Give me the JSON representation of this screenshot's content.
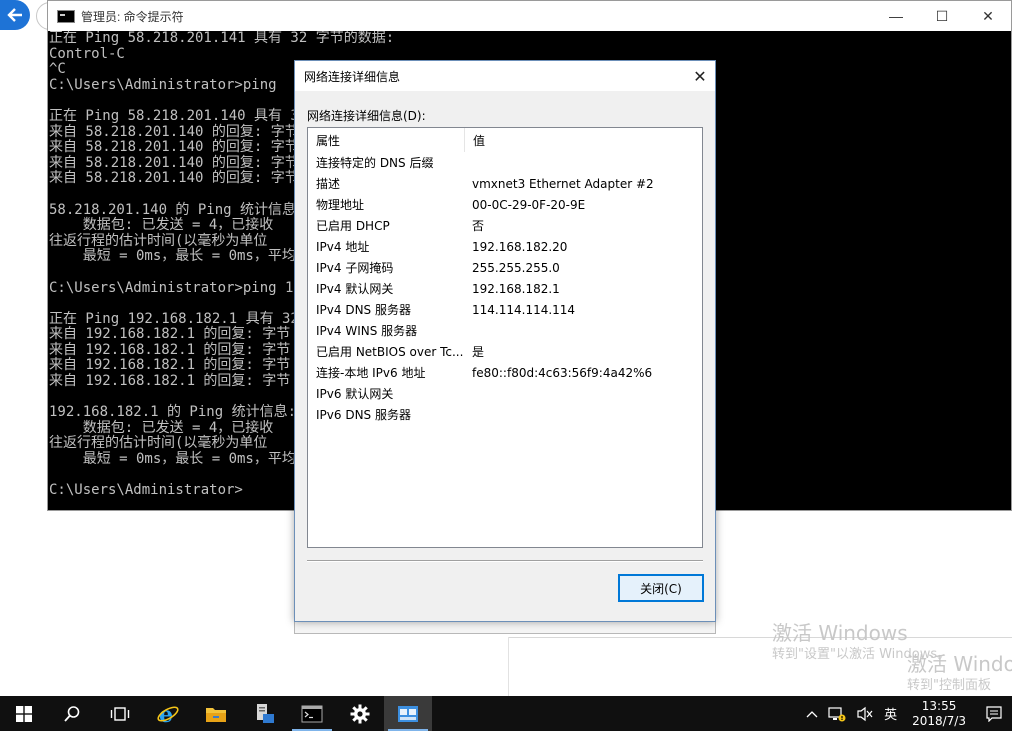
{
  "cmd": {
    "title": "管理员: 命令提示符",
    "lines": [
      "正在 Ping 58.218.201.141 具有 32 字节的数据:",
      "Control-C",
      "^C",
      "C:\\Users\\Administrator>ping  58",
      "",
      "正在 Ping 58.218.201.140 具有 3",
      "来自 58.218.201.140 的回复: 字节",
      "来自 58.218.201.140 的回复: 字节",
      "来自 58.218.201.140 的回复: 字节",
      "来自 58.218.201.140 的回复: 字节",
      "",
      "58.218.201.140 的 Ping 统计信息",
      "    数据包: 已发送 = 4，已接收",
      "往返行程的估计时间(以毫秒为单位",
      "    最短 = 0ms，最长 = 0ms，平均",
      "",
      "C:\\Users\\Administrator>ping 192",
      "",
      "正在 Ping 192.168.182.1 具有 32",
      "来自 192.168.182.1 的回复: 字节",
      "来自 192.168.182.1 的回复: 字节",
      "来自 192.168.182.1 的回复: 字节",
      "来自 192.168.182.1 的回复: 字节",
      "",
      "192.168.182.1 的 Ping 统计信息:",
      "    数据包: 已发送 = 4，已接收",
      "往返行程的估计时间(以毫秒为单位",
      "    最短 = 0ms，最长 = 0ms，平均",
      "",
      "C:\\Users\\Administrator>"
    ],
    "controls": {
      "minimize": "—",
      "maximize": "☐",
      "close": "✕"
    }
  },
  "dialog": {
    "title": "网络连接详细信息",
    "label": "网络连接详细信息(D):",
    "header": {
      "property": "属性",
      "value": "值"
    },
    "rows": [
      {
        "property": "连接特定的 DNS 后缀",
        "value": ""
      },
      {
        "property": "描述",
        "value": "vmxnet3 Ethernet Adapter #2"
      },
      {
        "property": "物理地址",
        "value": "00-0C-29-0F-20-9E"
      },
      {
        "property": "已启用 DHCP",
        "value": "否"
      },
      {
        "property": "IPv4 地址",
        "value": "192.168.182.20"
      },
      {
        "property": "IPv4 子网掩码",
        "value": "255.255.255.0"
      },
      {
        "property": "IPv4 默认网关",
        "value": "192.168.182.1"
      },
      {
        "property": "IPv4 DNS 服务器",
        "value": "114.114.114.114"
      },
      {
        "property": "IPv4 WINS 服务器",
        "value": ""
      },
      {
        "property": "已启用 NetBIOS over Tc...",
        "value": "是"
      },
      {
        "property": "连接-本地 IPv6 地址",
        "value": "fe80::f80d:4c63:56f9:4a42%6"
      },
      {
        "property": "IPv6 默认网关",
        "value": ""
      },
      {
        "property": "IPv6 DNS 服务器",
        "value": ""
      }
    ],
    "close_button": "关闭(C)",
    "close_icon": "✕"
  },
  "watermark": {
    "line1": "激活 Windows",
    "line2": "转到\"设置\"以激活 Windows。",
    "line3": "激活 Windo",
    "line4": "转到\"控制面板"
  },
  "taskbar": {
    "items": [
      {
        "name": "start-icon"
      },
      {
        "name": "search-icon"
      },
      {
        "name": "task-view-icon"
      },
      {
        "name": "ie-icon"
      },
      {
        "name": "file-explorer-icon"
      },
      {
        "name": "server-manager-icon"
      },
      {
        "name": "cmd-icon"
      },
      {
        "name": "settings-icon"
      },
      {
        "name": "network-control-panel-icon"
      }
    ],
    "tray": {
      "chevron": "^",
      "ime": "英",
      "time": "13:55",
      "date": "2018/7/3"
    }
  },
  "colors": {
    "accent": "#0078d7",
    "console_bg": "#000000",
    "console_fg": "#c0c0c0",
    "taskbar_bg": "#101010"
  }
}
